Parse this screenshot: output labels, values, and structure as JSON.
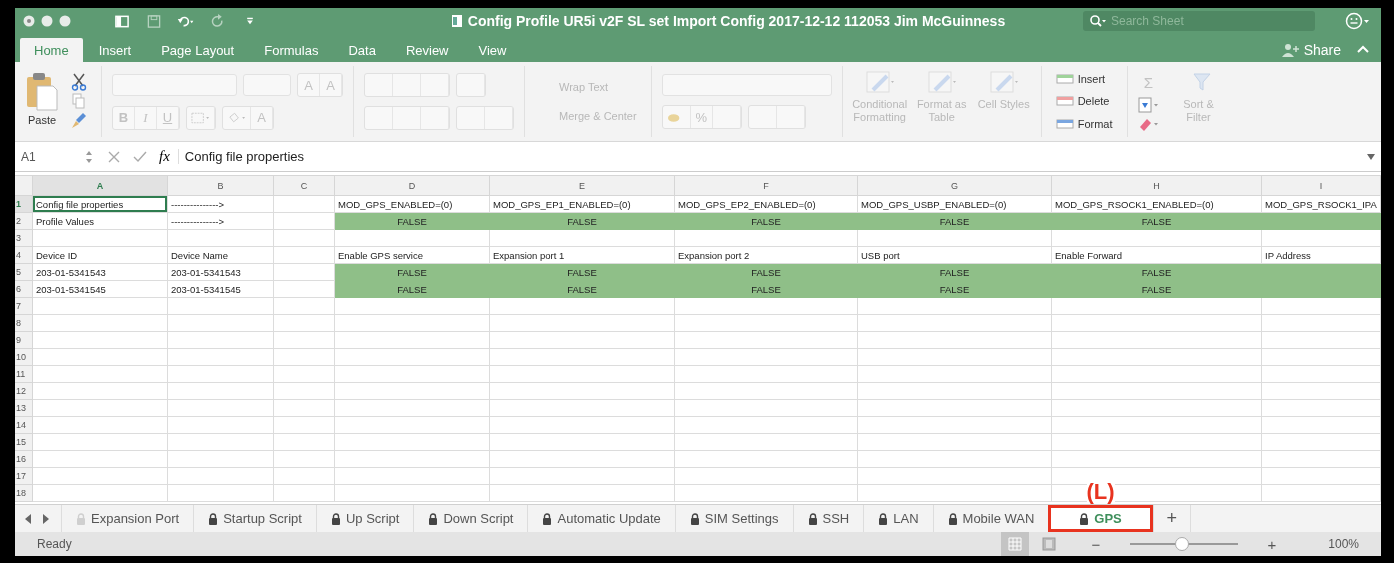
{
  "window": {
    "title": "Config Profile UR5i v2F SL set Import Config 2017-12-12 112053 Jim McGuinness"
  },
  "search": {
    "placeholder": "Search Sheet"
  },
  "ribbon_tabs": [
    {
      "label": "Home",
      "selected": true
    },
    {
      "label": "Insert",
      "selected": false
    },
    {
      "label": "Page Layout",
      "selected": false
    },
    {
      "label": "Formulas",
      "selected": false
    },
    {
      "label": "Data",
      "selected": false
    },
    {
      "label": "Review",
      "selected": false
    },
    {
      "label": "View",
      "selected": false
    }
  ],
  "share": {
    "label": "Share"
  },
  "ribbon": {
    "paste": {
      "label": "Paste"
    },
    "font_size_buttons": [
      {
        "label": "A",
        "disabled": true
      },
      {
        "label": "A",
        "disabled": true
      }
    ],
    "font_buttons": [
      {
        "label": "B",
        "disabled": true
      },
      {
        "label": "I",
        "disabled": true
      },
      {
        "label": "U",
        "disabled": true
      }
    ],
    "font_color": {
      "label": "A",
      "disabled": true
    },
    "alignment_buttons": [
      {
        "label": "Wrap Text",
        "disabled": true
      },
      {
        "label": "Merge & Center",
        "disabled": true
      }
    ],
    "number_buttons": [
      {
        "label": "%",
        "disabled": true
      }
    ],
    "style_buttons": [
      {
        "label": "Conditional Formatting",
        "disabled": true
      },
      {
        "label": "Format as Table",
        "disabled": true
      },
      {
        "label": "Cell Styles",
        "disabled": true
      }
    ],
    "cell_buttons": [
      {
        "label": "Insert",
        "disabled": false
      },
      {
        "label": "Delete",
        "disabled": false
      },
      {
        "label": "Format",
        "disabled": false
      }
    ],
    "sum": {
      "label": "Σ",
      "disabled": true
    },
    "sort": {
      "label": "Sort & Filter",
      "disabled": true
    }
  },
  "formula_bar": {
    "name_box": "A1",
    "fx": "fx",
    "value": "Config file properties"
  },
  "sheet": {
    "columns": [
      {
        "label": "A",
        "selected": true
      },
      {
        "label": "B",
        "selected": false
      },
      {
        "label": "C",
        "selected": false
      },
      {
        "label": "D",
        "selected": false
      },
      {
        "label": "E",
        "selected": false
      },
      {
        "label": "F",
        "selected": false
      },
      {
        "label": "G",
        "selected": false
      },
      {
        "label": "H",
        "selected": false
      },
      {
        "label": "I",
        "selected": false
      }
    ],
    "rows": [
      {
        "number": "1",
        "selected": true,
        "cells": [
          {
            "text": "Config file properties",
            "fill": false
          },
          {
            "text": "--------------->",
            "fill": false
          },
          {
            "fill": false
          },
          {
            "text": "MOD_GPS_ENABLED=(0)",
            "fill": false
          },
          {
            "text": "MOD_GPS_EP1_ENABLED=(0)",
            "fill": false
          },
          {
            "text": "MOD_GPS_EP2_ENABLED=(0)",
            "fill": false
          },
          {
            "text": "MOD_GPS_USBP_ENABLED=(0)",
            "fill": false
          },
          {
            "text": "MOD_GPS_RSOCK1_ENABLED=(0)",
            "fill": false
          },
          {
            "text": "MOD_GPS_RSOCK1_IPA",
            "fill": false
          }
        ]
      },
      {
        "number": "2",
        "selected": false,
        "cells": [
          {
            "text": "Profile Values",
            "fill": false
          },
          {
            "text": "--------------->",
            "fill": false
          },
          {
            "fill": false
          },
          {
            "text": "FALSE",
            "fill": true
          },
          {
            "text": "FALSE",
            "fill": true
          },
          {
            "text": "FALSE",
            "fill": true
          },
          {
            "text": "FALSE",
            "fill": true
          },
          {
            "text": "FALSE",
            "fill": true
          },
          {
            "fill": true
          }
        ]
      },
      {
        "number": "3",
        "selected": false
      },
      {
        "number": "4",
        "selected": false,
        "cells": [
          {
            "text": "Device ID",
            "fill": false
          },
          {
            "text": "Device Name",
            "fill": false
          },
          {
            "fill": false
          },
          {
            "text": "Enable GPS service",
            "fill": false
          },
          {
            "text": "Expansion port 1",
            "fill": false
          },
          {
            "text": "Expansion port 2",
            "fill": false
          },
          {
            "text": "USB port",
            "fill": false
          },
          {
            "text": "Enable Forward",
            "fill": false
          },
          {
            "text": "IP Address",
            "fill": false
          }
        ]
      },
      {
        "number": "5",
        "selected": false,
        "cells": [
          {
            "text": "203-01-5341543",
            "fill": false
          },
          {
            "text": "203-01-5341543",
            "fill": false
          },
          {
            "fill": false
          },
          {
            "text": "FALSE",
            "fill": true
          },
          {
            "text": "FALSE",
            "fill": true
          },
          {
            "text": "FALSE",
            "fill": true
          },
          {
            "text": "FALSE",
            "fill": true
          },
          {
            "text": "FALSE",
            "fill": true
          },
          {
            "fill": true
          }
        ]
      },
      {
        "number": "6",
        "selected": false,
        "cells": [
          {
            "text": "203-01-5341545",
            "fill": false
          },
          {
            "text": "203-01-5341545",
            "fill": false
          },
          {
            "fill": false
          },
          {
            "text": "FALSE",
            "fill": true
          },
          {
            "text": "FALSE",
            "fill": true
          },
          {
            "text": "FALSE",
            "fill": true
          },
          {
            "text": "FALSE",
            "fill": true
          },
          {
            "text": "FALSE",
            "fill": true
          },
          {
            "fill": true
          }
        ]
      },
      {
        "number": "7",
        "selected": false
      },
      {
        "number": "8",
        "selected": false
      },
      {
        "number": "9",
        "selected": false
      },
      {
        "number": "10",
        "selected": false
      },
      {
        "number": "11",
        "selected": false
      },
      {
        "number": "12",
        "selected": false
      },
      {
        "number": "13",
        "selected": false
      },
      {
        "number": "14",
        "selected": false
      },
      {
        "number": "15",
        "selected": false
      },
      {
        "number": "16",
        "selected": false
      },
      {
        "number": "17",
        "selected": false
      },
      {
        "number": "18",
        "selected": false
      }
    ]
  },
  "sheet_tabs": [
    {
      "label": "Expansion Port",
      "selected": false,
      "locked": true,
      "highlighted": false
    },
    {
      "label": "Startup Script",
      "selected": false,
      "locked": true,
      "highlighted": false
    },
    {
      "label": "Up Script",
      "selected": false,
      "locked": true,
      "highlighted": false
    },
    {
      "label": "Down Script",
      "selected": false,
      "locked": true,
      "highlighted": false
    },
    {
      "label": "Automatic Update",
      "selected": false,
      "locked": true,
      "highlighted": false
    },
    {
      "label": "SIM Settings",
      "selected": false,
      "locked": true,
      "highlighted": false
    },
    {
      "label": "SSH",
      "selected": false,
      "locked": true,
      "highlighted": false
    },
    {
      "label": "LAN",
      "selected": false,
      "locked": true,
      "highlighted": false
    },
    {
      "label": "Mobile WAN",
      "selected": false,
      "locked": true,
      "highlighted": false
    },
    {
      "label": "GPS",
      "selected": true,
      "locked": true,
      "highlighted": true
    }
  ],
  "add_sheet": "+",
  "annotation": {
    "label": "(L)"
  },
  "status_bar": {
    "status": "Ready",
    "zoom_out": "−",
    "zoom_in": "+",
    "zoom": {
      "level": 0.48,
      "reading": "100%"
    }
  }
}
